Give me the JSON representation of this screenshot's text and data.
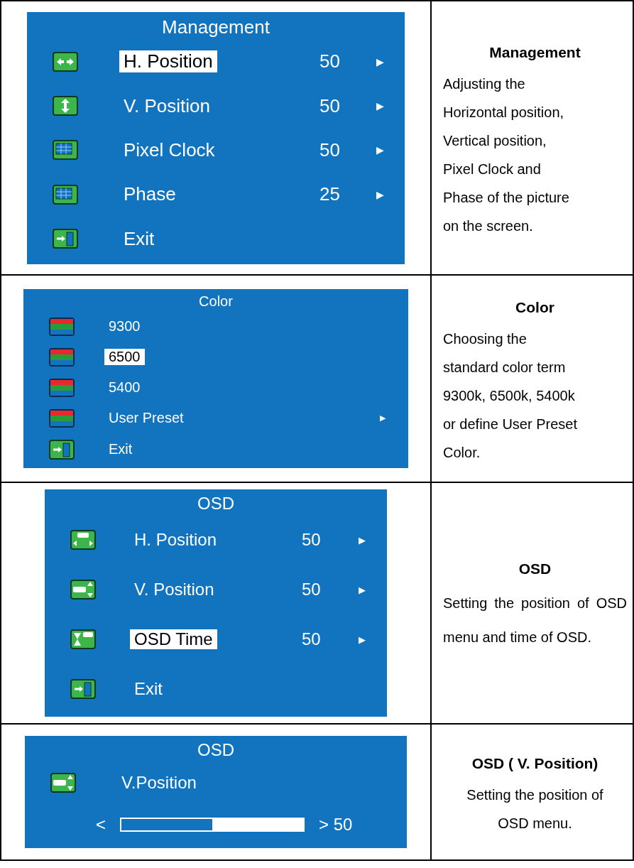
{
  "rows": [
    {
      "menu": {
        "kind": "list",
        "title": "Management",
        "items": [
          {
            "kind": "h-move",
            "label": "H. Position",
            "value": "50",
            "arrow": "▶",
            "selected": true
          },
          {
            "kind": "v-move",
            "label": "V. Position",
            "value": "50",
            "arrow": "▶",
            "selected": false
          },
          {
            "kind": "monitor",
            "label": "Pixel Clock",
            "value": "50",
            "arrow": "▶",
            "selected": false
          },
          {
            "kind": "monitor",
            "label": "Phase",
            "value": "25",
            "arrow": "▶",
            "selected": false
          },
          {
            "kind": "exit",
            "label": "Exit",
            "selected": false
          }
        ]
      },
      "description": {
        "title": "Management",
        "text": "Adjusting the\nHorizontal position,\nVertical position,\nPixel Clock and\nPhase of the picture\non the screen."
      }
    },
    {
      "menu": {
        "kind": "list",
        "title": "Color",
        "items": [
          {
            "kind": "color",
            "label": "9300",
            "selected": false
          },
          {
            "kind": "color",
            "label": "6500",
            "selected": true
          },
          {
            "kind": "color",
            "label": "5400",
            "selected": false
          },
          {
            "kind": "color",
            "label": "User Preset",
            "arrow": "▶",
            "selected": false
          },
          {
            "kind": "exit",
            "label": "Exit",
            "selected": false
          }
        ]
      },
      "description": {
        "title": "Color",
        "text": "Choosing the\nstandard color term\n9300k, 6500k, 5400k\nor define User Preset\nColor."
      }
    },
    {
      "menu": {
        "kind": "list",
        "title": "OSD",
        "items": [
          {
            "kind": "osd-h",
            "label": "H. Position",
            "value": "50",
            "arrow": "▶",
            "selected": false
          },
          {
            "kind": "osd-v",
            "label": "V. Position",
            "value": "50",
            "arrow": "▶",
            "selected": false
          },
          {
            "kind": "osd-time",
            "label": "OSD Time",
            "value": "50",
            "arrow": "▶",
            "selected": true
          },
          {
            "kind": "exit",
            "label": "Exit",
            "selected": false
          }
        ]
      },
      "description": {
        "title": "OSD",
        "text": "Setting the position of OSD menu and time of OSD."
      }
    },
    {
      "menu": {
        "kind": "slider",
        "title": "OSD",
        "label": "V.Position",
        "left": "<",
        "right": "> 50",
        "level": 0.5
      },
      "description": {
        "title": "OSD ( V. Position)",
        "text": "Setting the position of\nOSD menu."
      }
    }
  ]
}
